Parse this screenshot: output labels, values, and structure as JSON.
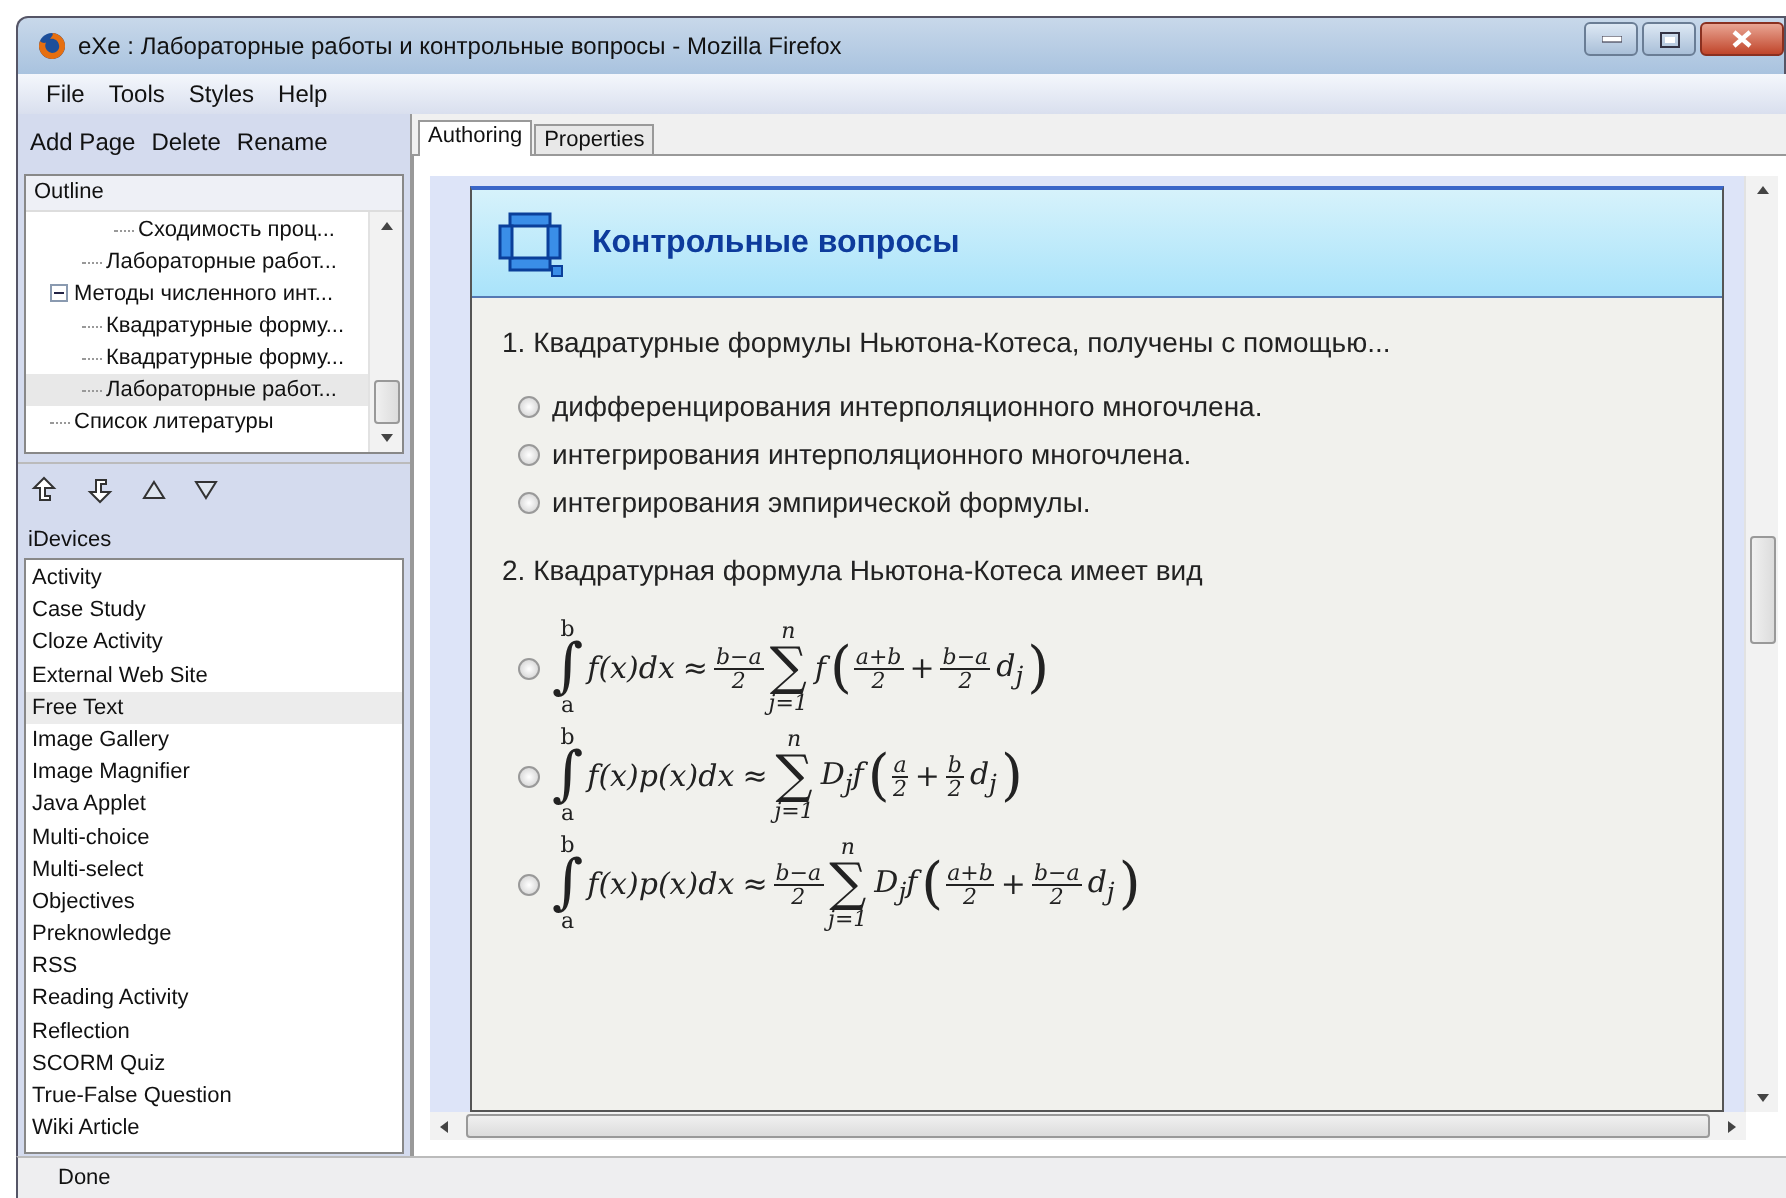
{
  "window": {
    "title": "eXe : Лабораторные работы и контрольные вопросы - Mozilla Firefox"
  },
  "menu": [
    "File",
    "Tools",
    "Styles",
    "Help"
  ],
  "outline_toolbar": [
    "Add Page",
    "Delete",
    "Rename"
  ],
  "outline": {
    "header": "Outline",
    "items": [
      {
        "children": [
          {
            "children": [
              {
                "label": "Сходимость проц...",
                "selected": false
              }
            ]
          },
          {
            "label": "Лабораторные работ...",
            "selected": false
          }
        ]
      },
      {
        "label": "Методы численного инт...",
        "expanded": true,
        "selected": false,
        "children": [
          {
            "label": "Квадратурные форму...",
            "selected": false
          },
          {
            "label": "Квадратурные форму...",
            "selected": false
          },
          {
            "label": "Лабораторные работ...",
            "selected": true
          }
        ]
      },
      {
        "label": "Список литературы",
        "selected": false
      }
    ]
  },
  "idevices": {
    "header": "iDevices",
    "items": [
      {
        "label": "Activity",
        "selected": false
      },
      {
        "label": "Case Study",
        "selected": false
      },
      {
        "label": "Cloze Activity",
        "selected": false
      },
      {
        "label": "External Web Site",
        "selected": false
      },
      {
        "label": "Free Text",
        "selected": true
      },
      {
        "label": "Image Gallery",
        "selected": false
      },
      {
        "label": "Image Magnifier",
        "selected": false
      },
      {
        "label": "Java Applet",
        "selected": false
      },
      {
        "label": "Multi-choice",
        "selected": false
      },
      {
        "label": "Multi-select",
        "selected": false
      },
      {
        "label": "Objectives",
        "selected": false
      },
      {
        "label": "Preknowledge",
        "selected": false
      },
      {
        "label": "RSS",
        "selected": false
      },
      {
        "label": "Reading Activity",
        "selected": false
      },
      {
        "label": "Reflection",
        "selected": false
      },
      {
        "label": "SCORM Quiz",
        "selected": false
      },
      {
        "label": "True-False Question",
        "selected": false
      },
      {
        "label": "Wiki Article",
        "selected": false
      }
    ]
  },
  "tabs": [
    {
      "label": "Authoring",
      "selected": true
    },
    {
      "label": "Properties",
      "selected": false
    }
  ],
  "idevice": {
    "title": "Контрольные вопросы",
    "questions": [
      {
        "text": "1. Квадратурные формулы Ньютона-Котеса, получены с помощью...",
        "options": [
          {
            "kind": "text",
            "text": "дифференцирования интерполяционного многочлена.",
            "selected": false
          },
          {
            "kind": "text",
            "text": "интегрирования интерполяционного многочлена.",
            "selected": false
          },
          {
            "kind": "text",
            "text": "интегрирования эмпирической формулы.",
            "selected": false
          }
        ]
      },
      {
        "text": "2. Квадратурная формула Ньютона-Котеса имеет вид",
        "options": [
          {
            "kind": "formula",
            "selected": false,
            "parts": [
              {
                "kind": "int",
                "sign": "∫",
                "upper": "b",
                "lower": "a"
              },
              {
                "kind": "text",
                "text": "f(x)dx"
              },
              {
                "kind": "text",
                "text": "≈"
              },
              {
                "kind": "frac",
                "num": "b−a",
                "den": "2"
              },
              {
                "kind": "sum",
                "sign": "∑",
                "upper": "n",
                "lower": "j=1"
              },
              {
                "kind": "text",
                "text": "f"
              },
              {
                "kind": "paren",
                "text": "("
              },
              {
                "kind": "frac",
                "num": "a+b",
                "den": "2"
              },
              {
                "kind": "text",
                "text": "+"
              },
              {
                "kind": "frac",
                "num": "b−a",
                "den": "2"
              },
              {
                "kind": "text",
                "text": "d$_{j}$"
              },
              {
                "kind": "paren",
                "text": ")"
              }
            ]
          },
          {
            "kind": "formula",
            "selected": false,
            "parts": [
              {
                "kind": "int",
                "sign": "∫",
                "upper": "b",
                "lower": "a"
              },
              {
                "kind": "text",
                "text": "f(x)p(x)dx"
              },
              {
                "kind": "text",
                "text": "≈"
              },
              {
                "kind": "sum",
                "sign": "∑",
                "upper": "n",
                "lower": "j=1"
              },
              {
                "kind": "text",
                "text": "D$_{j}$f"
              },
              {
                "kind": "paren",
                "text": "("
              },
              {
                "kind": "frac",
                "num": "a",
                "den": "2"
              },
              {
                "kind": "text",
                "text": "+"
              },
              {
                "kind": "frac",
                "num": "b",
                "den": "2"
              },
              {
                "kind": "text",
                "text": "d$_{j}$"
              },
              {
                "kind": "paren",
                "text": ")"
              }
            ]
          },
          {
            "kind": "formula",
            "selected": false,
            "parts": [
              {
                "kind": "int",
                "sign": "∫",
                "upper": "b",
                "lower": "a"
              },
              {
                "kind": "text",
                "text": "f(x)p(x)dx"
              },
              {
                "kind": "text",
                "text": "≈"
              },
              {
                "kind": "frac",
                "num": "b−a",
                "den": "2"
              },
              {
                "kind": "sum",
                "sign": "∑",
                "upper": "n",
                "lower": "j=1"
              },
              {
                "kind": "text",
                "text": "D$_{j}$f"
              },
              {
                "kind": "paren",
                "text": "("
              },
              {
                "kind": "frac",
                "num": "a+b",
                "den": "2"
              },
              {
                "kind": "text",
                "text": "+"
              },
              {
                "kind": "frac",
                "num": "b−a",
                "den": "2"
              },
              {
                "kind": "text",
                "text": "d$_{j}$"
              },
              {
                "kind": "paren",
                "text": ")"
              }
            ]
          }
        ]
      }
    ]
  },
  "status_bar": {
    "text": "Done"
  }
}
